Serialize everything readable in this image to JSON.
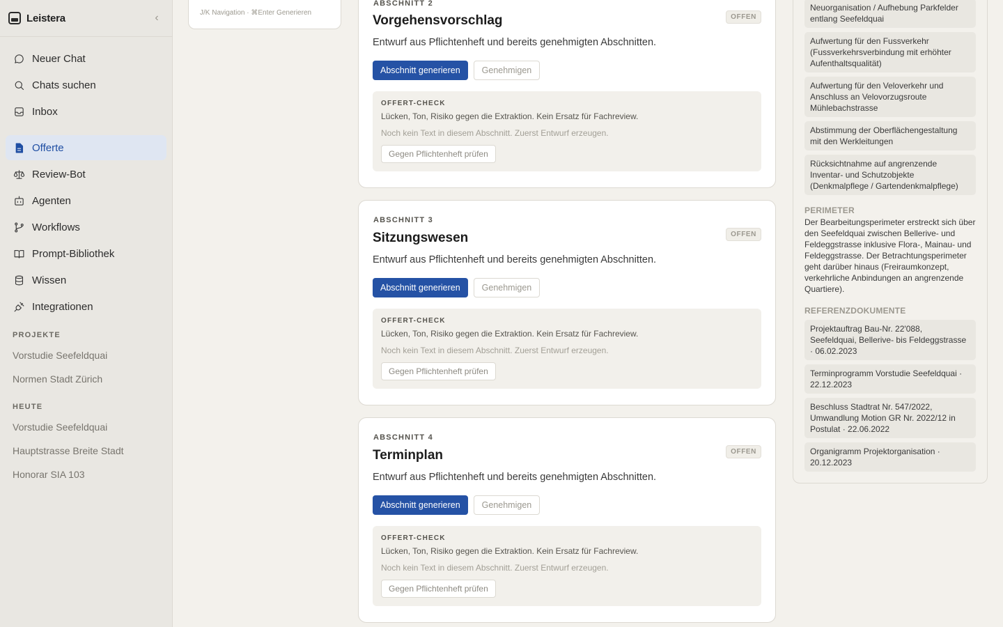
{
  "app": {
    "name": "Leistera"
  },
  "nav": {
    "primary": [
      {
        "label": "Neuer Chat",
        "icon": "chat-bubble-icon"
      },
      {
        "label": "Chats suchen",
        "icon": "search-icon"
      },
      {
        "label": "Inbox",
        "icon": "inbox-icon"
      }
    ],
    "secondary": [
      {
        "label": "Offerte",
        "icon": "document-icon",
        "active": true
      },
      {
        "label": "Review-Bot",
        "icon": "scale-icon"
      },
      {
        "label": "Agenten",
        "icon": "robot-icon"
      },
      {
        "label": "Workflows",
        "icon": "git-branch-icon"
      },
      {
        "label": "Prompt-Bibliothek",
        "icon": "book-icon"
      },
      {
        "label": "Wissen",
        "icon": "database-icon"
      },
      {
        "label": "Integrationen",
        "icon": "plug-icon"
      }
    ]
  },
  "projects": {
    "label": "PROJEKTE",
    "items": [
      "Vorstudie Seefeldquai",
      "Normen Stadt Zürich"
    ]
  },
  "today": {
    "label": "HEUTE",
    "items": [
      "Vorstudie Seefeldquai",
      "Hauptstrasse Breite Stadt",
      "Honorar SIA 103"
    ]
  },
  "mini_card": {
    "hint": "J/K Navigation · ⌘Enter Generieren"
  },
  "sections": [
    {
      "number": "ABSCHNITT 2",
      "title": "Vorgehensvorschlag",
      "status": "OFFEN",
      "description": "Entwurf aus Pflichtenheft und bereits genehmigten Abschnitten.",
      "generate_label": "Abschnitt generieren",
      "approve_label": "Genehmigen",
      "check": {
        "title": "OFFERT-CHECK",
        "description": "Lücken, Ton, Risiko gegen die Extraktion. Kein Ersatz für Fachreview.",
        "empty": "Noch kein Text in diesem Abschnitt. Zuerst Entwurf erzeugen.",
        "button": "Gegen Pflichtenheft prüfen"
      }
    },
    {
      "number": "ABSCHNITT 3",
      "title": "Sitzungswesen",
      "status": "OFFEN",
      "description": "Entwurf aus Pflichtenheft und bereits genehmigten Abschnitten.",
      "generate_label": "Abschnitt generieren",
      "approve_label": "Genehmigen",
      "check": {
        "title": "OFFERT-CHECK",
        "description": "Lücken, Ton, Risiko gegen die Extraktion. Kein Ersatz für Fachreview.",
        "empty": "Noch kein Text in diesem Abschnitt. Zuerst Entwurf erzeugen.",
        "button": "Gegen Pflichtenheft prüfen"
      }
    },
    {
      "number": "ABSCHNITT 4",
      "title": "Terminplan",
      "status": "OFFEN",
      "description": "Entwurf aus Pflichtenheft und bereits genehmigten Abschnitten.",
      "generate_label": "Abschnitt generieren",
      "approve_label": "Genehmigen",
      "check": {
        "title": "OFFERT-CHECK",
        "description": "Lücken, Ton, Risiko gegen die Extraktion. Kein Ersatz für Fachreview.",
        "empty": "Noch kein Text in diesem Abschnitt. Zuerst Entwurf erzeugen.",
        "button": "Gegen Pflichtenheft prüfen"
      }
    }
  ],
  "right_panel": {
    "goals": [
      "Neuorganisation / Aufhebung Parkfelder entlang Seefeldquai",
      "Aufwertung für den Fussverkehr (Fussverkehrsverbindung mit erhöhter Aufenthaltsqualität)",
      "Aufwertung für den Veloverkehr und Anschluss an Velovorzugsroute Mühlebachstrasse",
      "Abstimmung der Oberflächengestaltung mit den Werkleitungen",
      "Rücksichtnahme auf angrenzende Inventar- und Schutzobjekte (Denkmalpflege / Gartendenkmalpflege)"
    ],
    "perimeter_label": "PERIMETER",
    "perimeter_text": "Der Bearbeitungsperimeter erstreckt sich über den Seefeldquai zwischen Bellerive- und Feldeggstrasse inklusive Flora-, Mainau- und Feldeggstrasse. Der Betrachtungsperimeter geht darüber hinaus (Freiraumkonzept, verkehrliche Anbindungen an angrenzende Quartiere).",
    "references_label": "REFERENZDOKUMENTE",
    "references": [
      "Projektauftrag Bau-Nr. 22'088, Seefeldquai, Bellerive- bis Feldeggstrasse · 06.02.2023",
      "Terminprogramm Vorstudie Seefeldquai · 22.12.2023",
      "Beschluss Stadtrat Nr. 547/2022, Umwandlung Motion GR Nr. 2022/12 in Postulat · 22.06.2022",
      "Organigramm Projektorganisation · 20.12.2023"
    ]
  }
}
